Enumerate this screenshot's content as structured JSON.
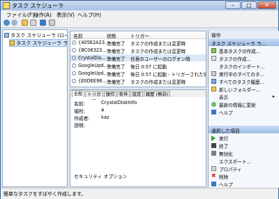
{
  "window": {
    "title": "タスク スケジューラ"
  },
  "menu": [
    "ファイル(F)",
    "操作(A)",
    "表示(V)",
    "ヘルプ(H)"
  ],
  "tree": {
    "items": [
      "タスク スケジューラ (ロー...",
      "タスク スケジューラ ラ..."
    ]
  },
  "task_list": {
    "columns": [
      "名前",
      "状態",
      "トリガー"
    ],
    "rows": [
      {
        "name": "{405E2A23...",
        "status": "準備完了",
        "trigger": "タスクの作成または変更時"
      },
      {
        "name": "{BC06323...",
        "status": "準備完了",
        "trigger": "タスクの作成または変更時"
      },
      {
        "name": "CrystalDis...",
        "status": "準備完了",
        "trigger": "任意のユーザーのログオン時"
      },
      {
        "name": "GoogleUpd...",
        "status": "準備完了",
        "trigger": "毎日 0:57 に起動"
      },
      {
        "name": "GoogleUpd...",
        "status": "準備完了",
        "trigger": "毎日 0:57 に起動 - トリガーされた後"
      },
      {
        "name": "{E0DEE98...",
        "status": "準備完了",
        "trigger": "タスクの作成または変更時"
      }
    ]
  },
  "details": {
    "tabs": [
      "全般",
      "トリガー",
      "操作",
      "条件",
      "設定",
      "履歴 (無効)"
    ],
    "labels": {
      "name": "名前:",
      "location": "場所:",
      "author": "作成者:",
      "description": "説明:"
    },
    "values": {
      "name": "CrystalDiskInfo",
      "location": "¥",
      "author": "kaz",
      "description": ""
    },
    "security_label": "セキュリティ オプション"
  },
  "operations": {
    "header": "操作",
    "section1": "タスク スケジューラ ラ...",
    "items1": [
      "基本タスクの作成...",
      "タスクの作成...",
      "タスクのインポート...",
      "実行中のすべてのタ...",
      "すべてのタスク履歴...",
      "新しいフォルダー...",
      "表示",
      "最新の情報に更新",
      "ヘルプ"
    ],
    "section2": "選択した項目",
    "items2": [
      "実行",
      "終了",
      "無効化",
      "エクスポート...",
      "プロパティ",
      "削除",
      "ヘルプ"
    ]
  },
  "status_bar": "簡単なタスクをすばやく作成します。"
}
